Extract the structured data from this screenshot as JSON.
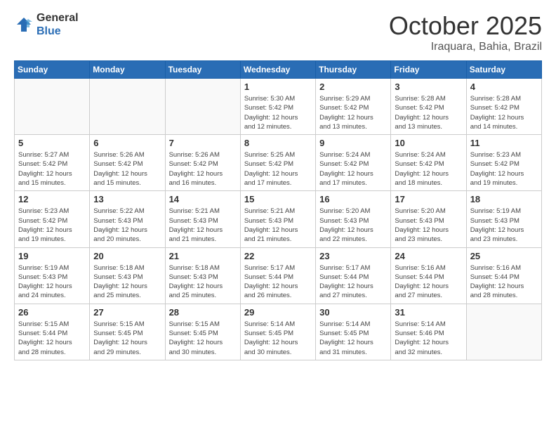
{
  "header": {
    "logo": {
      "general": "General",
      "blue": "Blue"
    },
    "title": "October 2025",
    "subtitle": "Iraquara, Bahia, Brazil"
  },
  "days_of_week": [
    "Sunday",
    "Monday",
    "Tuesday",
    "Wednesday",
    "Thursday",
    "Friday",
    "Saturday"
  ],
  "weeks": [
    [
      {
        "day": "",
        "info": ""
      },
      {
        "day": "",
        "info": ""
      },
      {
        "day": "",
        "info": ""
      },
      {
        "day": "1",
        "info": "Sunrise: 5:30 AM\nSunset: 5:42 PM\nDaylight: 12 hours\nand 12 minutes."
      },
      {
        "day": "2",
        "info": "Sunrise: 5:29 AM\nSunset: 5:42 PM\nDaylight: 12 hours\nand 13 minutes."
      },
      {
        "day": "3",
        "info": "Sunrise: 5:28 AM\nSunset: 5:42 PM\nDaylight: 12 hours\nand 13 minutes."
      },
      {
        "day": "4",
        "info": "Sunrise: 5:28 AM\nSunset: 5:42 PM\nDaylight: 12 hours\nand 14 minutes."
      }
    ],
    [
      {
        "day": "5",
        "info": "Sunrise: 5:27 AM\nSunset: 5:42 PM\nDaylight: 12 hours\nand 15 minutes."
      },
      {
        "day": "6",
        "info": "Sunrise: 5:26 AM\nSunset: 5:42 PM\nDaylight: 12 hours\nand 15 minutes."
      },
      {
        "day": "7",
        "info": "Sunrise: 5:26 AM\nSunset: 5:42 PM\nDaylight: 12 hours\nand 16 minutes."
      },
      {
        "day": "8",
        "info": "Sunrise: 5:25 AM\nSunset: 5:42 PM\nDaylight: 12 hours\nand 17 minutes."
      },
      {
        "day": "9",
        "info": "Sunrise: 5:24 AM\nSunset: 5:42 PM\nDaylight: 12 hours\nand 17 minutes."
      },
      {
        "day": "10",
        "info": "Sunrise: 5:24 AM\nSunset: 5:42 PM\nDaylight: 12 hours\nand 18 minutes."
      },
      {
        "day": "11",
        "info": "Sunrise: 5:23 AM\nSunset: 5:42 PM\nDaylight: 12 hours\nand 19 minutes."
      }
    ],
    [
      {
        "day": "12",
        "info": "Sunrise: 5:23 AM\nSunset: 5:42 PM\nDaylight: 12 hours\nand 19 minutes."
      },
      {
        "day": "13",
        "info": "Sunrise: 5:22 AM\nSunset: 5:43 PM\nDaylight: 12 hours\nand 20 minutes."
      },
      {
        "day": "14",
        "info": "Sunrise: 5:21 AM\nSunset: 5:43 PM\nDaylight: 12 hours\nand 21 minutes."
      },
      {
        "day": "15",
        "info": "Sunrise: 5:21 AM\nSunset: 5:43 PM\nDaylight: 12 hours\nand 21 minutes."
      },
      {
        "day": "16",
        "info": "Sunrise: 5:20 AM\nSunset: 5:43 PM\nDaylight: 12 hours\nand 22 minutes."
      },
      {
        "day": "17",
        "info": "Sunrise: 5:20 AM\nSunset: 5:43 PM\nDaylight: 12 hours\nand 23 minutes."
      },
      {
        "day": "18",
        "info": "Sunrise: 5:19 AM\nSunset: 5:43 PM\nDaylight: 12 hours\nand 23 minutes."
      }
    ],
    [
      {
        "day": "19",
        "info": "Sunrise: 5:19 AM\nSunset: 5:43 PM\nDaylight: 12 hours\nand 24 minutes."
      },
      {
        "day": "20",
        "info": "Sunrise: 5:18 AM\nSunset: 5:43 PM\nDaylight: 12 hours\nand 25 minutes."
      },
      {
        "day": "21",
        "info": "Sunrise: 5:18 AM\nSunset: 5:43 PM\nDaylight: 12 hours\nand 25 minutes."
      },
      {
        "day": "22",
        "info": "Sunrise: 5:17 AM\nSunset: 5:44 PM\nDaylight: 12 hours\nand 26 minutes."
      },
      {
        "day": "23",
        "info": "Sunrise: 5:17 AM\nSunset: 5:44 PM\nDaylight: 12 hours\nand 27 minutes."
      },
      {
        "day": "24",
        "info": "Sunrise: 5:16 AM\nSunset: 5:44 PM\nDaylight: 12 hours\nand 27 minutes."
      },
      {
        "day": "25",
        "info": "Sunrise: 5:16 AM\nSunset: 5:44 PM\nDaylight: 12 hours\nand 28 minutes."
      }
    ],
    [
      {
        "day": "26",
        "info": "Sunrise: 5:15 AM\nSunset: 5:44 PM\nDaylight: 12 hours\nand 28 minutes."
      },
      {
        "day": "27",
        "info": "Sunrise: 5:15 AM\nSunset: 5:45 PM\nDaylight: 12 hours\nand 29 minutes."
      },
      {
        "day": "28",
        "info": "Sunrise: 5:15 AM\nSunset: 5:45 PM\nDaylight: 12 hours\nand 30 minutes."
      },
      {
        "day": "29",
        "info": "Sunrise: 5:14 AM\nSunset: 5:45 PM\nDaylight: 12 hours\nand 30 minutes."
      },
      {
        "day": "30",
        "info": "Sunrise: 5:14 AM\nSunset: 5:45 PM\nDaylight: 12 hours\nand 31 minutes."
      },
      {
        "day": "31",
        "info": "Sunrise: 5:14 AM\nSunset: 5:46 PM\nDaylight: 12 hours\nand 32 minutes."
      },
      {
        "day": "",
        "info": ""
      }
    ]
  ]
}
